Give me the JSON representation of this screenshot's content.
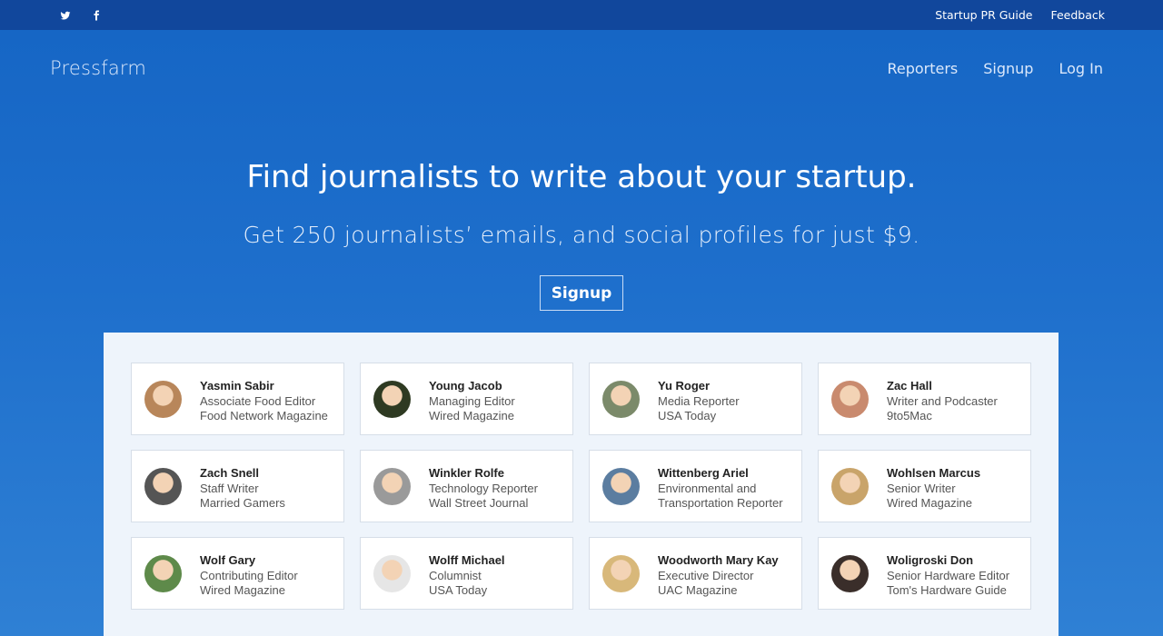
{
  "topbar": {
    "social": [
      {
        "icon": "twitter-icon"
      },
      {
        "icon": "facebook-icon"
      }
    ],
    "links": [
      "Startup PR Guide",
      "Feedback"
    ],
    "bg_color": "#11479c"
  },
  "header": {
    "brand": "Pressfarm",
    "nav": [
      "Reporters",
      "Signup",
      "Log In"
    ]
  },
  "hero": {
    "title": "Find journalists to write about your startup.",
    "subtitle": "Get 250 journalists’ emails, and social profiles for just $9.",
    "cta_label": "Signup"
  },
  "reporters": [
    {
      "name": "Yasmin Sabir",
      "role": "Associate Food Editor",
      "outlet": "Food Network Magazine",
      "avatar_color": "#b8865a"
    },
    {
      "name": "Young Jacob",
      "role": "Managing Editor",
      "outlet": "Wired Magazine",
      "avatar_color": "#2e3a22"
    },
    {
      "name": "Yu Roger",
      "role": "Media Reporter",
      "outlet": "USA Today",
      "avatar_color": "#7b8a6a"
    },
    {
      "name": "Zac Hall",
      "role": "Writer and Podcaster",
      "outlet": "9to5Mac",
      "avatar_color": "#c98a6e"
    },
    {
      "name": "Zach Snell",
      "role": "Staff Writer",
      "outlet": "Married Gamers",
      "avatar_color": "#555555"
    },
    {
      "name": "Winkler Rolfe",
      "role": "Technology Reporter",
      "outlet": "Wall Street Journal",
      "avatar_color": "#9a9a9a"
    },
    {
      "name": "Wittenberg Ariel",
      "role": "Environmental and",
      "outlet": "Transportation Reporter",
      "avatar_color": "#5b7da0"
    },
    {
      "name": "Wohlsen Marcus",
      "role": "Senior Writer",
      "outlet": "Wired Magazine",
      "avatar_color": "#c9a46a"
    },
    {
      "name": "Wolf Gary",
      "role": "Contributing Editor",
      "outlet": "Wired Magazine",
      "avatar_color": "#5e8a4a"
    },
    {
      "name": "Wolff Michael",
      "role": "Columnist",
      "outlet": "USA Today",
      "avatar_color": "#e6e6e6"
    },
    {
      "name": "Woodworth Mary Kay",
      "role": "Executive Director",
      "outlet": "UAC Magazine",
      "avatar_color": "#d8b87a"
    },
    {
      "name": "Woligroski Don",
      "role": "Senior Hardware Editor",
      "outlet": "Tom's Hardware Guide",
      "avatar_color": "#3a2e2a"
    }
  ]
}
